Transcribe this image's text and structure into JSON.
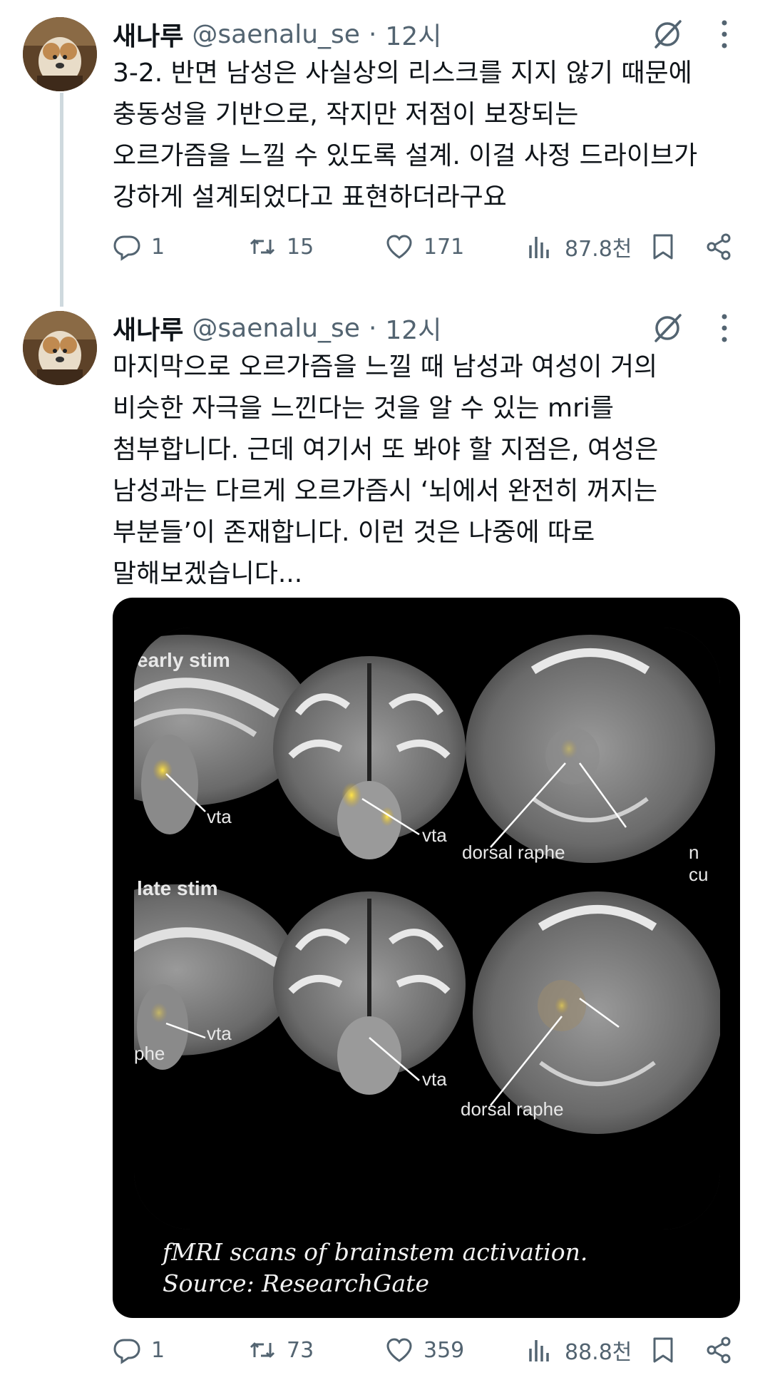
{
  "tweets": [
    {
      "author": {
        "name": "새나루",
        "handle": "@saenalu_se",
        "dot": "·",
        "time": "12시"
      },
      "text": "3-2. 반면 남성은 사실상의 리스크를 지지 않기 때문에\n충동성을 기반으로, 작지만 저점이 보장되는\n오르가즘을 느낄 수 있도록 설계. 이걸 사정 드라이브가\n강하게 설계되었다고 표현하더라구요",
      "stats": {
        "replies": "1",
        "retweets": "15",
        "likes": "171",
        "views": "87.8천"
      }
    },
    {
      "author": {
        "name": "새나루",
        "handle": "@saenalu_se",
        "dot": "·",
        "time": "12시"
      },
      "text": "마지막으로 오르가즘을 느낄 때 남성과 여성이 거의\n비슷한 자극을 느낀다는 것을 알 수 있는 mri를\n첨부합니다. 근데 여기서 또 봐야 할 지점은, 여성은\n남성과는 다르게 오르가즘시 ‘뇌에서 완전히 꺼지는\n부분들’이 존재합니다. 이런 것은 나중에 따로\n말해보겠습니다...",
      "media": {
        "labels": {
          "early": "early stim",
          "late": "late stim",
          "vta": "vta",
          "dorsal_raphe": "dorsal raphe",
          "n_cut": "n cu",
          "phe": "phe"
        },
        "caption_line1": "fMRI scans of brainstem activation.",
        "caption_line2": "Source: ResearchGate"
      },
      "stats": {
        "replies": "1",
        "retweets": "73",
        "likes": "359",
        "views": "88.8천"
      }
    }
  ],
  "icons": {
    "reply": "reply-icon",
    "retweet": "retweet-icon",
    "like": "heart-icon",
    "views": "views-icon",
    "bookmark": "bookmark-icon",
    "share": "share-icon",
    "grok": "grok-icon",
    "more": "more-icon"
  },
  "colors": {
    "text": "#0f1419",
    "secondary": "#536471",
    "thread_line": "#cfd9de",
    "activation": "#e6c83a"
  }
}
